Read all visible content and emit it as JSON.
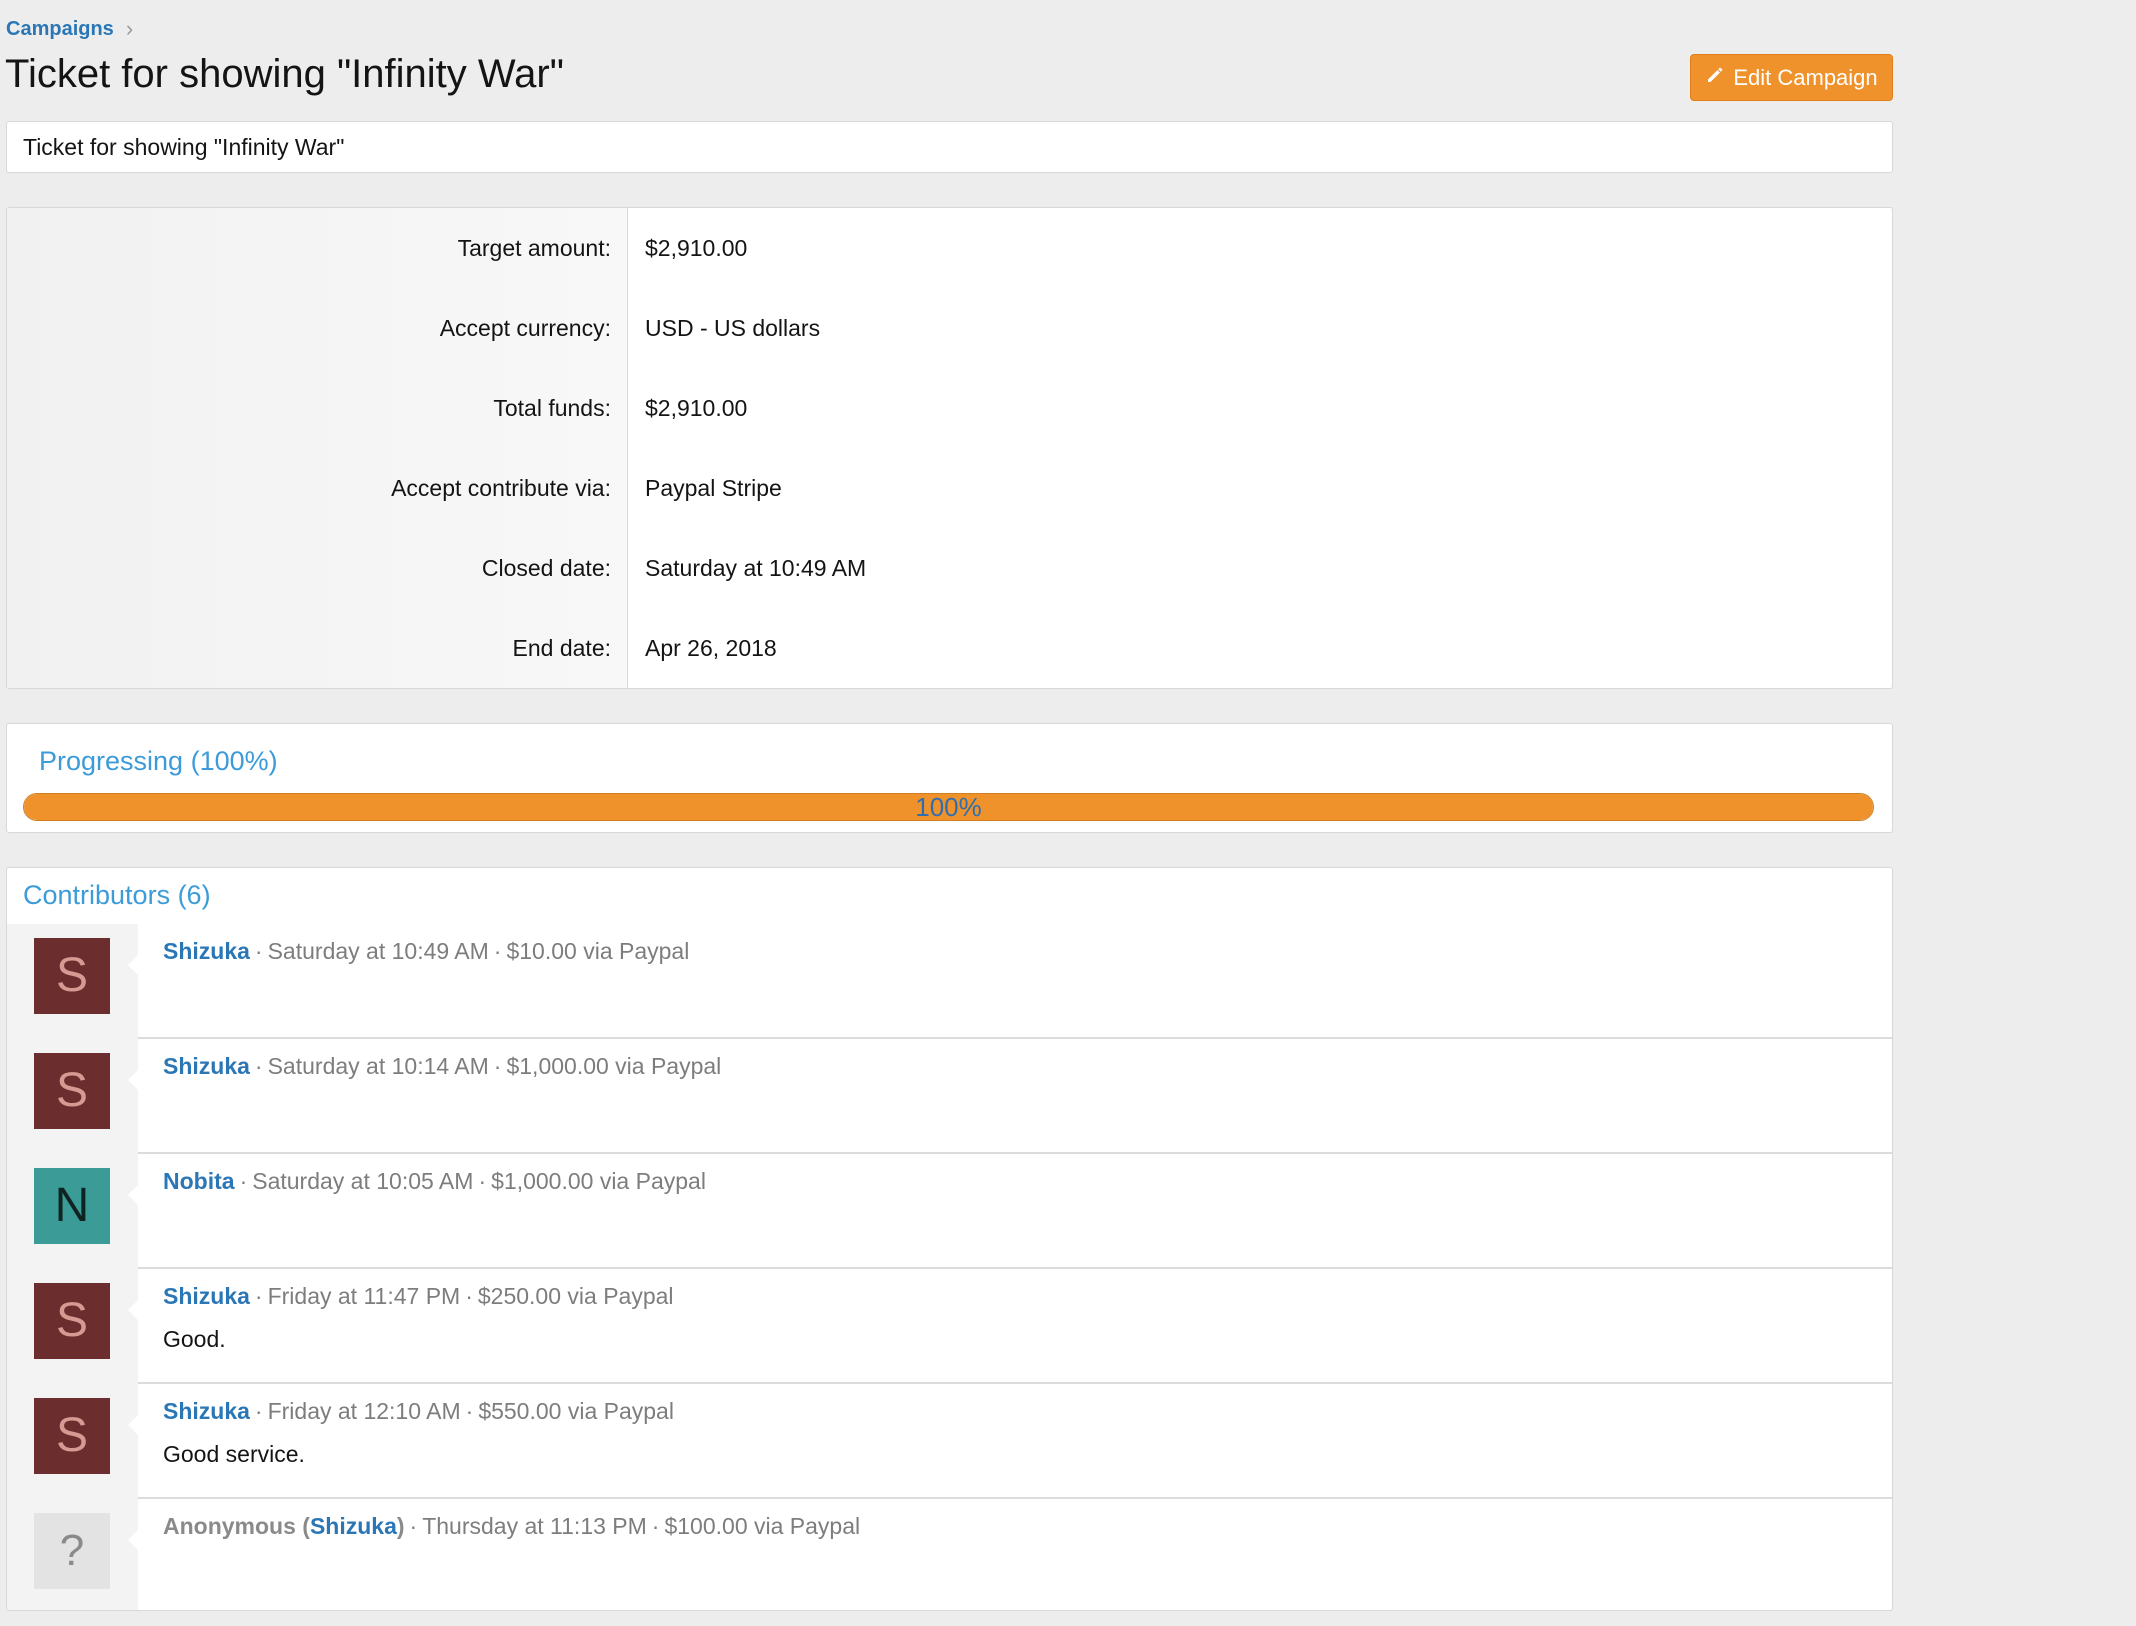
{
  "breadcrumb": {
    "item": "Campaigns",
    "separator": "›"
  },
  "page": {
    "title": "Ticket for showing \"Infinity War\"",
    "edit_button_label": "Edit Campaign",
    "description": "Ticket for showing \"Infinity War\""
  },
  "info": {
    "rows": [
      {
        "label": "Target amount:",
        "value": "$2,910.00"
      },
      {
        "label": "Accept currency:",
        "value": "USD - US dollars"
      },
      {
        "label": "Total funds:",
        "value": "$2,910.00"
      },
      {
        "label": "Accept contribute via:",
        "value": "Paypal Stripe"
      },
      {
        "label": "Closed date:",
        "value": "Saturday at 10:49 AM"
      },
      {
        "label": "End date:",
        "value": "Apr 26, 2018"
      }
    ]
  },
  "progress": {
    "title": "Progressing (100%)",
    "percent": 100,
    "label": "100%",
    "fill_color": "#f0922c"
  },
  "contributors": {
    "title": "Contributors (6)",
    "items": [
      {
        "avatar": "S",
        "avatar_style": "s",
        "name": "Shizuka",
        "time": "Saturday at 10:49 AM",
        "amount": "$10.00 via Paypal",
        "message": ""
      },
      {
        "avatar": "S",
        "avatar_style": "s",
        "name": "Shizuka",
        "time": "Saturday at 10:14 AM",
        "amount": "$1,000.00 via Paypal",
        "message": ""
      },
      {
        "avatar": "N",
        "avatar_style": "n",
        "name": "Nobita",
        "time": "Saturday at 10:05 AM",
        "amount": "$1,000.00 via Paypal",
        "message": ""
      },
      {
        "avatar": "S",
        "avatar_style": "s",
        "name": "Shizuka",
        "time": "Friday at 11:47 PM",
        "amount": "$250.00 via Paypal",
        "message": "Good."
      },
      {
        "avatar": "S",
        "avatar_style": "s",
        "name": "Shizuka",
        "time": "Friday at 12:10 AM",
        "amount": "$550.00 via Paypal",
        "message": "Good service."
      },
      {
        "avatar": "?",
        "avatar_style": "q",
        "name": "Anonymous",
        "real_name": "Shizuka",
        "time": "Thursday at 11:13 PM",
        "amount": "$100.00 via Paypal",
        "message": ""
      }
    ]
  },
  "colors": {
    "accent_orange": "#f0922c",
    "link_blue": "#2b77b6",
    "heading_blue": "#3c9bd8"
  }
}
